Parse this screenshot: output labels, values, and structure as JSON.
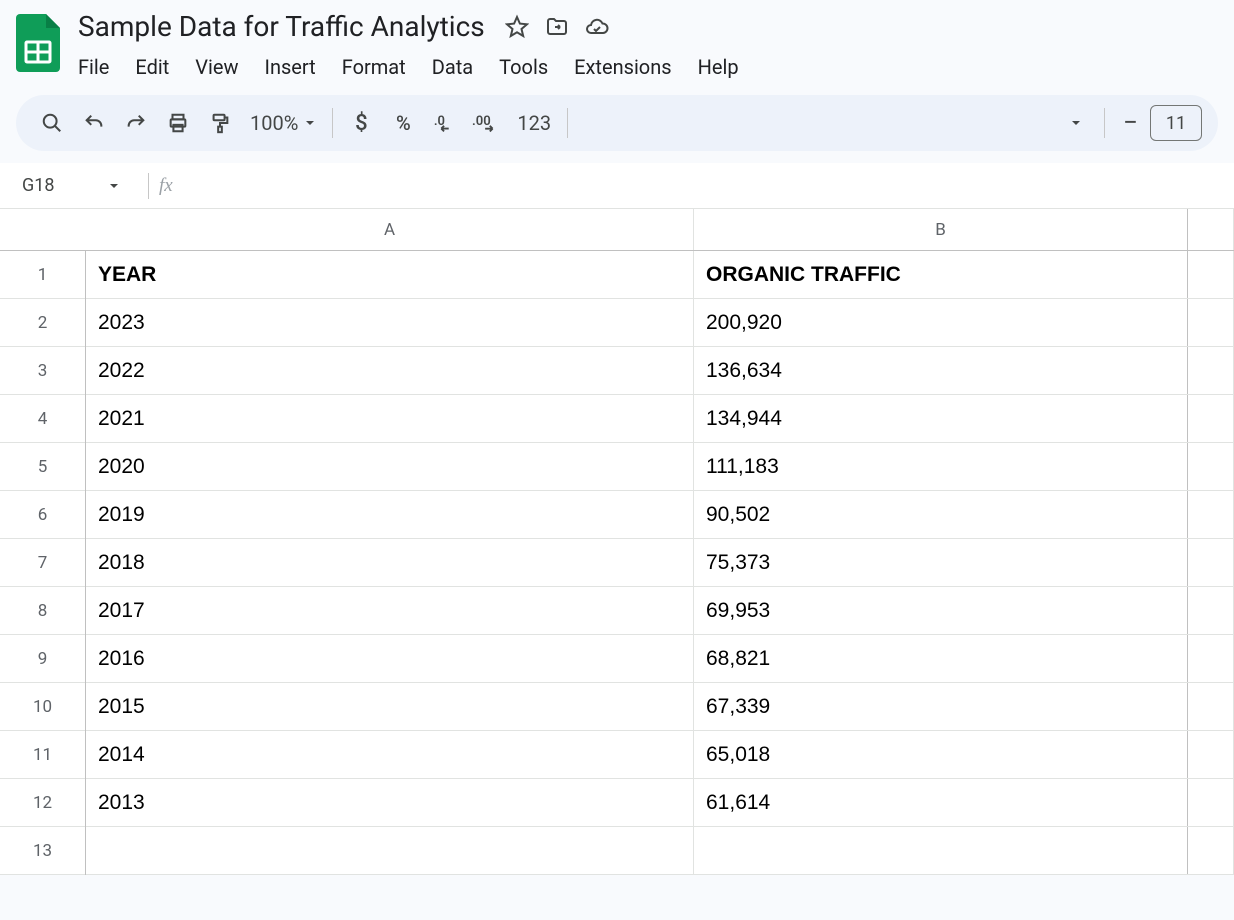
{
  "doc_title": "Sample Data for Traffic Analytics",
  "menu": [
    "File",
    "Edit",
    "View",
    "Insert",
    "Format",
    "Data",
    "Tools",
    "Extensions",
    "Help"
  ],
  "toolbar": {
    "zoom": "100%",
    "font_size": "11",
    "num_fmt": "123"
  },
  "name_box": "G18",
  "formula": "",
  "columns": [
    "A",
    "B"
  ],
  "sheet": {
    "headers": [
      "YEAR",
      "ORGANIC TRAFFIC"
    ],
    "rows": [
      {
        "year": "2023",
        "traffic": "200,920"
      },
      {
        "year": "2022",
        "traffic": "136,634"
      },
      {
        "year": "2021",
        "traffic": "134,944"
      },
      {
        "year": "2020",
        "traffic": "111,183"
      },
      {
        "year": "2019",
        "traffic": "90,502"
      },
      {
        "year": "2018",
        "traffic": "75,373"
      },
      {
        "year": "2017",
        "traffic": "69,953"
      },
      {
        "year": "2016",
        "traffic": "68,821"
      },
      {
        "year": "2015",
        "traffic": "67,339"
      },
      {
        "year": "2014",
        "traffic": "65,018"
      },
      {
        "year": "2013",
        "traffic": "61,614"
      }
    ]
  },
  "row_numbers": [
    "1",
    "2",
    "3",
    "4",
    "5",
    "6",
    "7",
    "8",
    "9",
    "10",
    "11",
    "12",
    "13"
  ]
}
